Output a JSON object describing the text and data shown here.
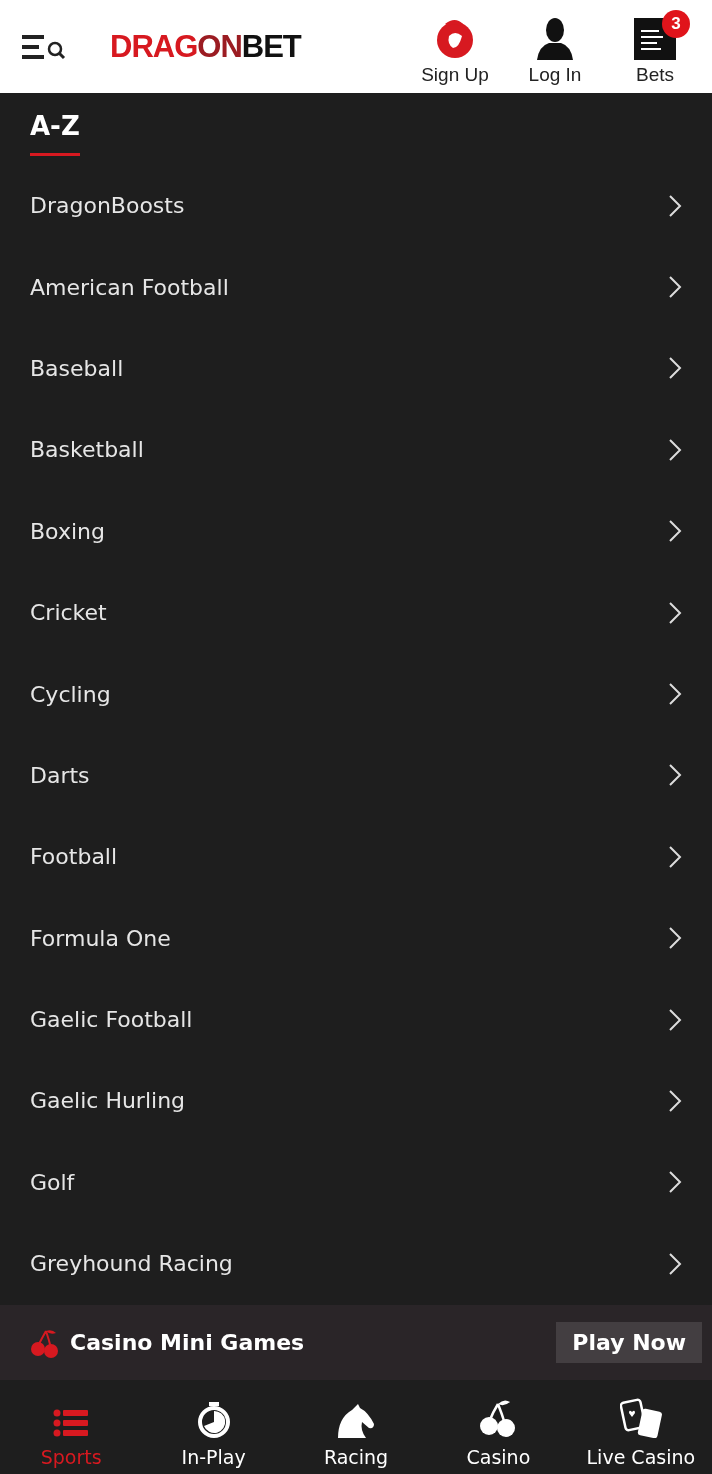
{
  "header": {
    "logo": [
      {
        "text": "DRAG",
        "color": "#d71920"
      },
      {
        "text": "ON",
        "color": "#9b1c22"
      },
      {
        "text": "BET",
        "color": "#111111"
      }
    ],
    "actions": [
      {
        "kind": "signup",
        "label": "Sign Up"
      },
      {
        "kind": "login",
        "label": "Log In"
      },
      {
        "kind": "bets",
        "label": "Bets",
        "badge": "3"
      }
    ]
  },
  "section_title": "A-Z",
  "sports": [
    "DragonBoosts",
    "American Football",
    "Baseball",
    "Basketball",
    "Boxing",
    "Cricket",
    "Cycling",
    "Darts",
    "Football",
    "Formula One",
    "Gaelic Football",
    "Gaelic Hurling",
    "Golf",
    "Greyhound Racing"
  ],
  "promo": {
    "title": "Casino Mini Games",
    "button": "Play Now"
  },
  "bottom_nav": [
    {
      "kind": "sports",
      "label": "Sports",
      "selected": true
    },
    {
      "kind": "inplay",
      "label": "In-Play",
      "selected": false
    },
    {
      "kind": "racing",
      "label": "Racing",
      "selected": false
    },
    {
      "kind": "casino",
      "label": "Casino",
      "selected": false
    },
    {
      "kind": "livecasino",
      "label": "Live Casino",
      "selected": false
    }
  ]
}
